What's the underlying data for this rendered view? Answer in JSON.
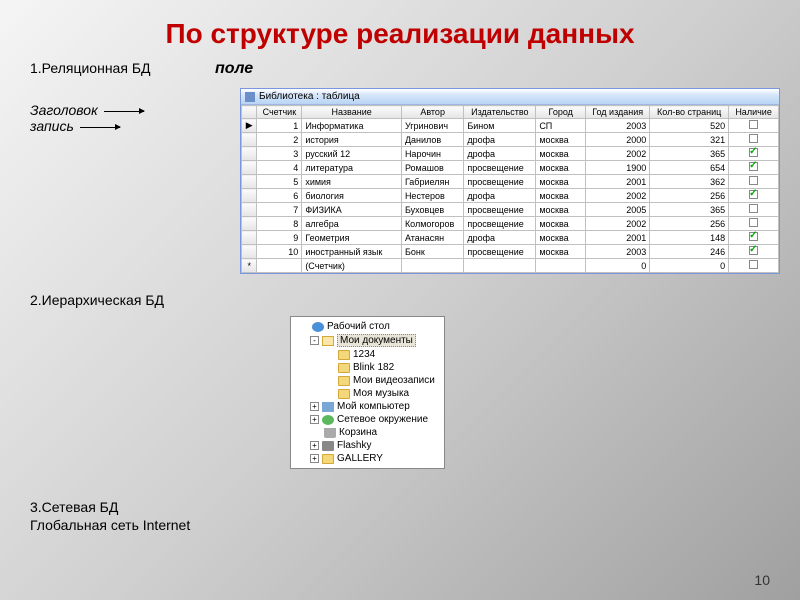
{
  "title": "По структуре реализации данных",
  "page_number": "10",
  "labels": {
    "relational": "1.Реляционная БД",
    "pole": "поле",
    "zagolovok": "Заголовок",
    "zapis": "запись",
    "hierarchical": "2.Иерархическая БД",
    "network": "3.Сетевая БД",
    "global": "Глобальная сеть Internet"
  },
  "table": {
    "window_title": "Библиотека : таблица",
    "headers": [
      "",
      "Счетчик",
      "Название",
      "Автор",
      "Издательство",
      "Город",
      "Год издания",
      "Кол-во страниц",
      "Наличие"
    ],
    "rows": [
      {
        "id": "1",
        "name": "Информатика",
        "author": "Угринович",
        "pub": "Бином",
        "city": "СП",
        "year": "2003",
        "pages": "520",
        "avail": false
      },
      {
        "id": "2",
        "name": "история",
        "author": "Данилов",
        "pub": "дрофа",
        "city": "москва",
        "year": "2000",
        "pages": "321",
        "avail": false
      },
      {
        "id": "3",
        "name": "русский 12",
        "author": "Нарочин",
        "pub": "дрофа",
        "city": "москва",
        "year": "2002",
        "pages": "365",
        "avail": true
      },
      {
        "id": "4",
        "name": "литература",
        "author": "Ромашов",
        "pub": "просвещение",
        "city": "москва",
        "year": "1900",
        "pages": "654",
        "avail": true
      },
      {
        "id": "5",
        "name": "химия",
        "author": "Габриелян",
        "pub": "просвещение",
        "city": "москва",
        "year": "2001",
        "pages": "362",
        "avail": false
      },
      {
        "id": "6",
        "name": "биология",
        "author": "Нестеров",
        "pub": "дрофа",
        "city": "москва",
        "year": "2002",
        "pages": "256",
        "avail": true
      },
      {
        "id": "7",
        "name": "ФИЗИКА",
        "author": "Буховцев",
        "pub": "просвещение",
        "city": "москва",
        "year": "2005",
        "pages": "365",
        "avail": false
      },
      {
        "id": "8",
        "name": "алгебра",
        "author": "Колмогоров",
        "pub": "просвещение",
        "city": "москва",
        "year": "2002",
        "pages": "256",
        "avail": false
      },
      {
        "id": "9",
        "name": "Геометрия",
        "author": "Атанасян",
        "pub": "дрофа",
        "city": "москва",
        "year": "2001",
        "pages": "148",
        "avail": true
      },
      {
        "id": "10",
        "name": "иностранный язык",
        "author": "Бонк",
        "pub": "просвещение",
        "city": "москва",
        "year": "2003",
        "pages": "246",
        "avail": true
      }
    ],
    "new_row": {
      "marker": "*",
      "counter": "(Счетчик)",
      "zero1": "0",
      "zero2": "0"
    }
  },
  "tree": {
    "items": [
      {
        "level": 1,
        "exp": "",
        "icon": "desktop",
        "label": "Рабочий стол",
        "sel": false
      },
      {
        "level": 2,
        "exp": "-",
        "icon": "folder-open",
        "label": "Мои документы",
        "sel": true
      },
      {
        "level": 3,
        "exp": "",
        "icon": "folder",
        "label": "1234",
        "sel": false
      },
      {
        "level": 3,
        "exp": "",
        "icon": "folder",
        "label": "Blink 182",
        "sel": false
      },
      {
        "level": 3,
        "exp": "",
        "icon": "folder",
        "label": "Мои видеозаписи",
        "sel": false
      },
      {
        "level": 3,
        "exp": "",
        "icon": "folder",
        "label": "Моя музыка",
        "sel": false
      },
      {
        "level": 2,
        "exp": "+",
        "icon": "mycomp",
        "label": "Мой компьютер",
        "sel": false
      },
      {
        "level": 2,
        "exp": "+",
        "icon": "network",
        "label": "Сетевое окружение",
        "sel": false
      },
      {
        "level": 2,
        "exp": "",
        "icon": "trash",
        "label": "Корзина",
        "sel": false
      },
      {
        "level": 2,
        "exp": "+",
        "icon": "drive",
        "label": "Flashky",
        "sel": false
      },
      {
        "level": 2,
        "exp": "+",
        "icon": "folder",
        "label": "GALLERY",
        "sel": false
      }
    ]
  }
}
